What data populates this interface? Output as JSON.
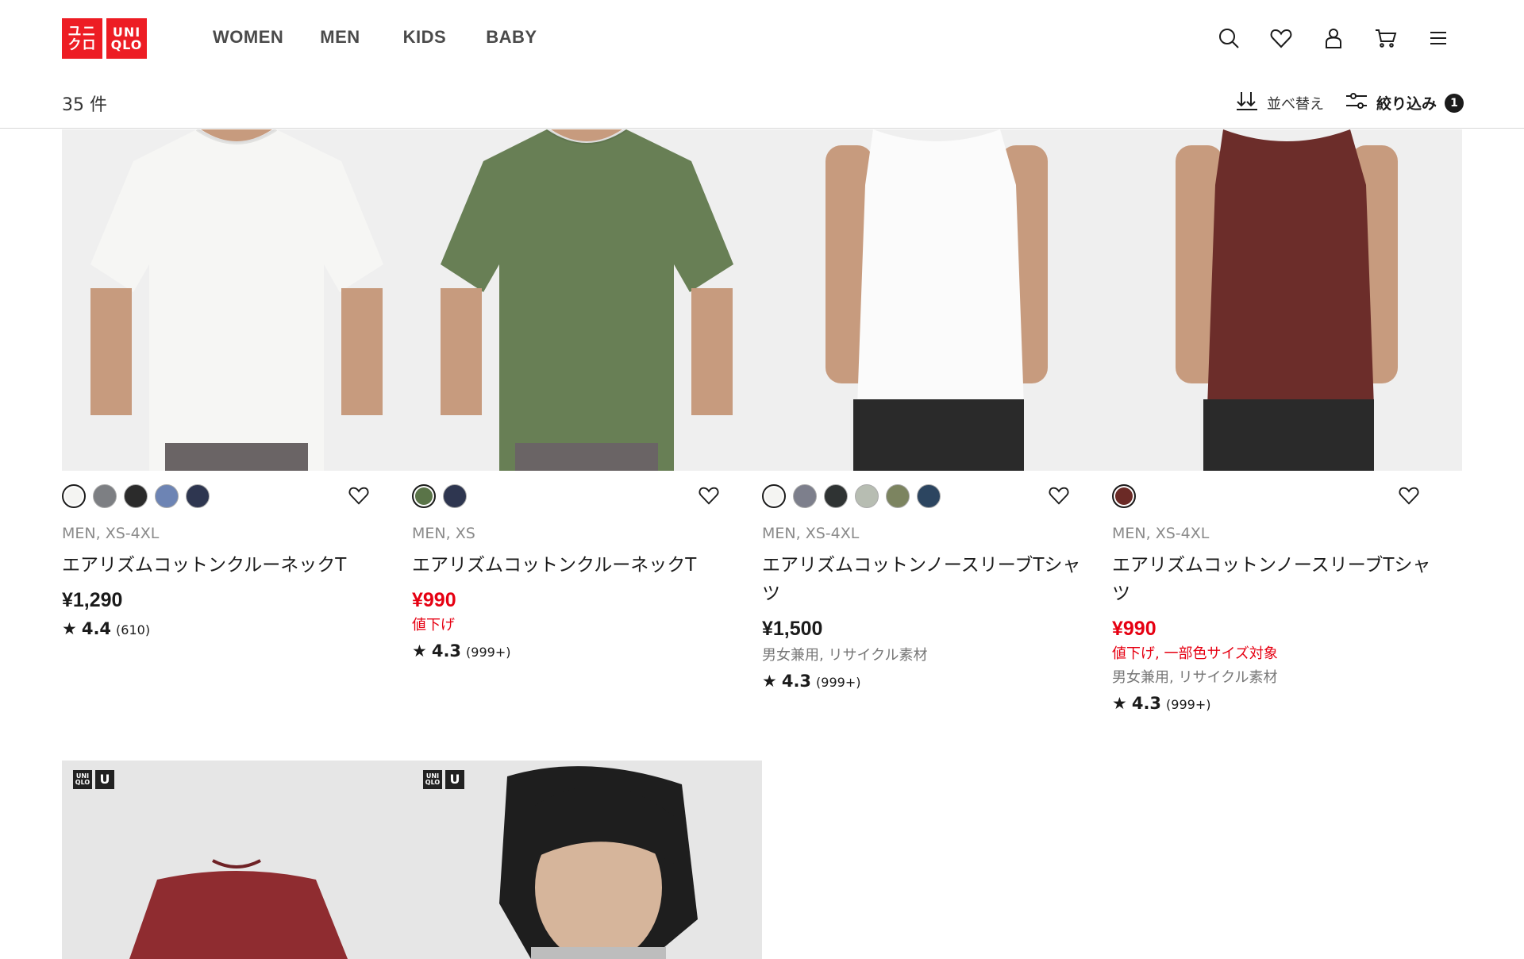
{
  "header": {
    "logo": {
      "kana_top": "ユニ",
      "kana_bottom": "クロ",
      "latin_top": "UNI",
      "latin_bottom": "QLO"
    },
    "nav": [
      "WOMEN",
      "MEN",
      "KIDS",
      "BABY"
    ],
    "icons": [
      "search-icon",
      "heart-icon",
      "user-icon",
      "cart-icon",
      "menu-icon"
    ]
  },
  "toolbar": {
    "count": "35 件",
    "sort_label": "並べ替え",
    "filter_label": "絞り込み",
    "filter_count": "1"
  },
  "products": [
    {
      "gender_size": "MEN, XS-4XL",
      "name": "エアリズムコットンクルーネックT",
      "price": "¥1,290",
      "sale": false,
      "flag": "",
      "note": "",
      "rating": "4.4",
      "reviews": "(610)",
      "swatches": [
        "#f4f4f2",
        "#7d7f83",
        "#2b2b2b",
        "#6d84b4",
        "#2e3650"
      ],
      "selected_swatch": 0,
      "shirt_color": "#f6f6f4",
      "style": "tee"
    },
    {
      "gender_size": "MEN, XS",
      "name": "エアリズムコットンクルーネックT",
      "price": "¥990",
      "sale": true,
      "flag": "値下げ",
      "note": "",
      "rating": "4.3",
      "reviews": "(999+)",
      "swatches": [
        "#5a7448",
        "#2e3650"
      ],
      "selected_swatch": 0,
      "shirt_color": "#687f55",
      "style": "tee"
    },
    {
      "gender_size": "MEN, XS-4XL",
      "name": "エアリズムコットンノースリーブTシャツ",
      "price": "¥1,500",
      "sale": false,
      "flag": "",
      "note": "男女兼用, リサイクル素材",
      "rating": "4.3",
      "reviews": "(999+)",
      "swatches": [
        "#f4f4f2",
        "#7d7f8c",
        "#2f3333",
        "#b7bdb2",
        "#7c8460",
        "#2c4560"
      ],
      "selected_swatch": 0,
      "shirt_color": "#fbfbfb",
      "style": "sleeveless"
    },
    {
      "gender_size": "MEN, XS-4XL",
      "name": "エアリズムコットンノースリーブTシャツ",
      "price": "¥990",
      "sale": true,
      "flag": "値下げ, 一部色サイズ対象",
      "note": "男女兼用, リサイクル素材",
      "rating": "4.3",
      "reviews": "(999+)",
      "swatches": [
        "#6b2a26"
      ],
      "selected_swatch": 0,
      "shirt_color": "#6c2d2a",
      "style": "sleeveless"
    }
  ],
  "second_row": [
    {
      "tag1_top": "UNI",
      "tag1_bottom": "QLO",
      "tag2": "U",
      "shirt_color": "#8f2c30"
    },
    {
      "tag1_top": "UNI",
      "tag1_bottom": "QLO",
      "tag2": "U",
      "shirt_color": "#bdbdbd"
    }
  ],
  "colors": {
    "brand_red": "#ed1d24",
    "sale_red": "#e60012"
  }
}
